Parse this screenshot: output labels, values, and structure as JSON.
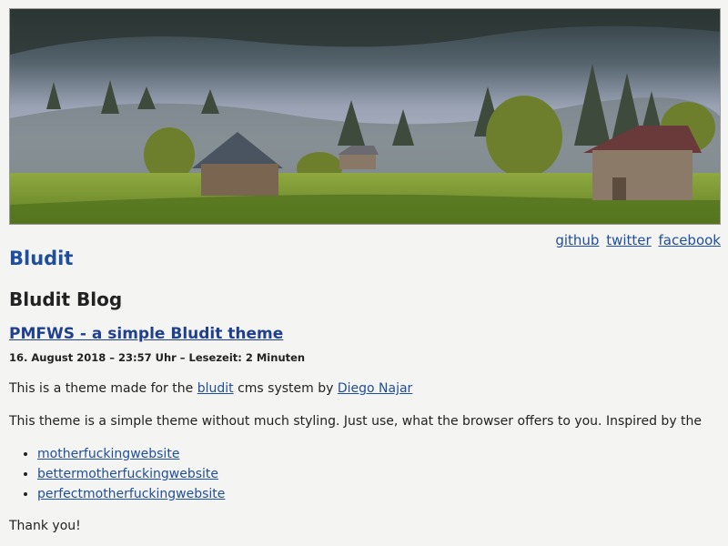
{
  "header": {
    "social_links": [
      {
        "label": "github"
      },
      {
        "label": "twitter"
      },
      {
        "label": "facebook"
      }
    ],
    "site_title": "Bludit"
  },
  "main": {
    "blog_title": "Bludit Blog",
    "post": {
      "title": "PMFWS - a simple Bludit theme",
      "meta": "16. August 2018 – 23:57 Uhr – Lesezeit: 2 Minuten",
      "intro_prefix": "This is a theme made for the ",
      "intro_link1": "bludit",
      "intro_middle": " cms system by ",
      "intro_link2": "Diego Najar",
      "paragraph2": "This theme is a simple theme without much styling. Just use, what the browser offers to you. Inspired by the",
      "links": [
        {
          "label": "motherfuckingwebsite"
        },
        {
          "label": "bettermotherfuckingwebsite"
        },
        {
          "label": "perfectmotherfuckingwebsite"
        }
      ],
      "closing": "Thank you!"
    }
  },
  "colors": {
    "background": "#f4f4f2",
    "link": "#1f4e9e",
    "site_title": "#1f4e9e"
  }
}
